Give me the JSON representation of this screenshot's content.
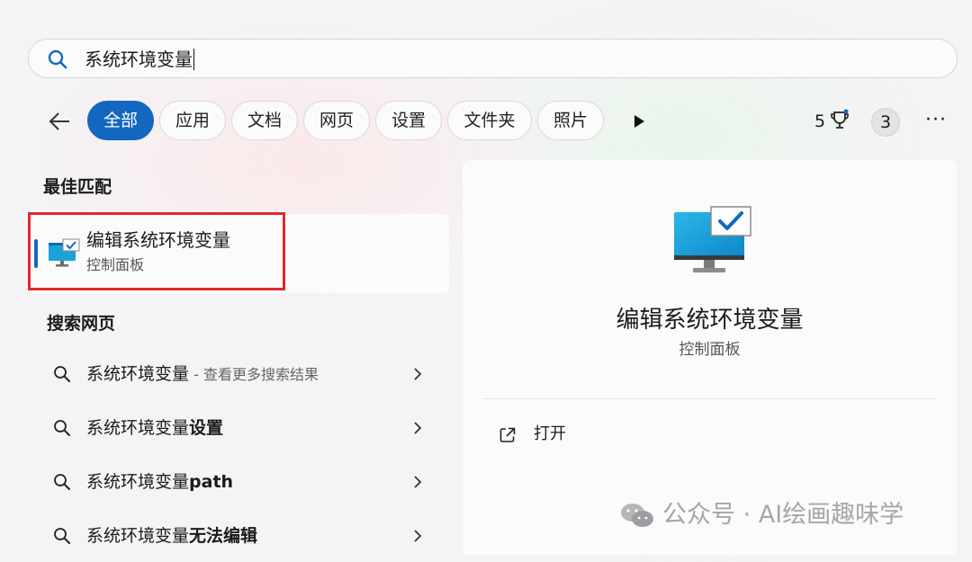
{
  "search": {
    "query": "系统环境变量"
  },
  "filters": [
    "全部",
    "应用",
    "文档",
    "网页",
    "设置",
    "文件夹",
    "照片"
  ],
  "header_right": {
    "points": "5",
    "badge": "3",
    "more": "···"
  },
  "best_match": {
    "heading": "最佳匹配",
    "title": "编辑系统环境变量",
    "subtitle": "控制面板"
  },
  "web": {
    "heading": "搜索网页",
    "items": [
      {
        "prefix": "系统环境变量",
        "bold": "",
        "hint": " - 查看更多搜索结果"
      },
      {
        "prefix": "系统环境变量",
        "bold": "设置",
        "hint": ""
      },
      {
        "prefix": "系统环境变量",
        "bold": "path",
        "hint": ""
      },
      {
        "prefix": "系统环境变量",
        "bold": "无法编辑",
        "hint": ""
      }
    ]
  },
  "detail": {
    "title": "编辑系统环境变量",
    "subtitle": "控制面板",
    "action_open": "打开"
  },
  "watermark": {
    "text": "公众号 · AI绘画趣味学"
  },
  "colors": {
    "accent": "#1467c0",
    "highlight_frame": "#e0282e",
    "search_icon": "#1467c0"
  },
  "icons": {
    "search": "search-icon",
    "back": "back-arrow-icon",
    "more_filters": "play-icon",
    "rewards": "trophy-icon",
    "app": "monitor-check-icon",
    "open": "open-external-icon",
    "row_chevron": "chevron-right-icon"
  }
}
